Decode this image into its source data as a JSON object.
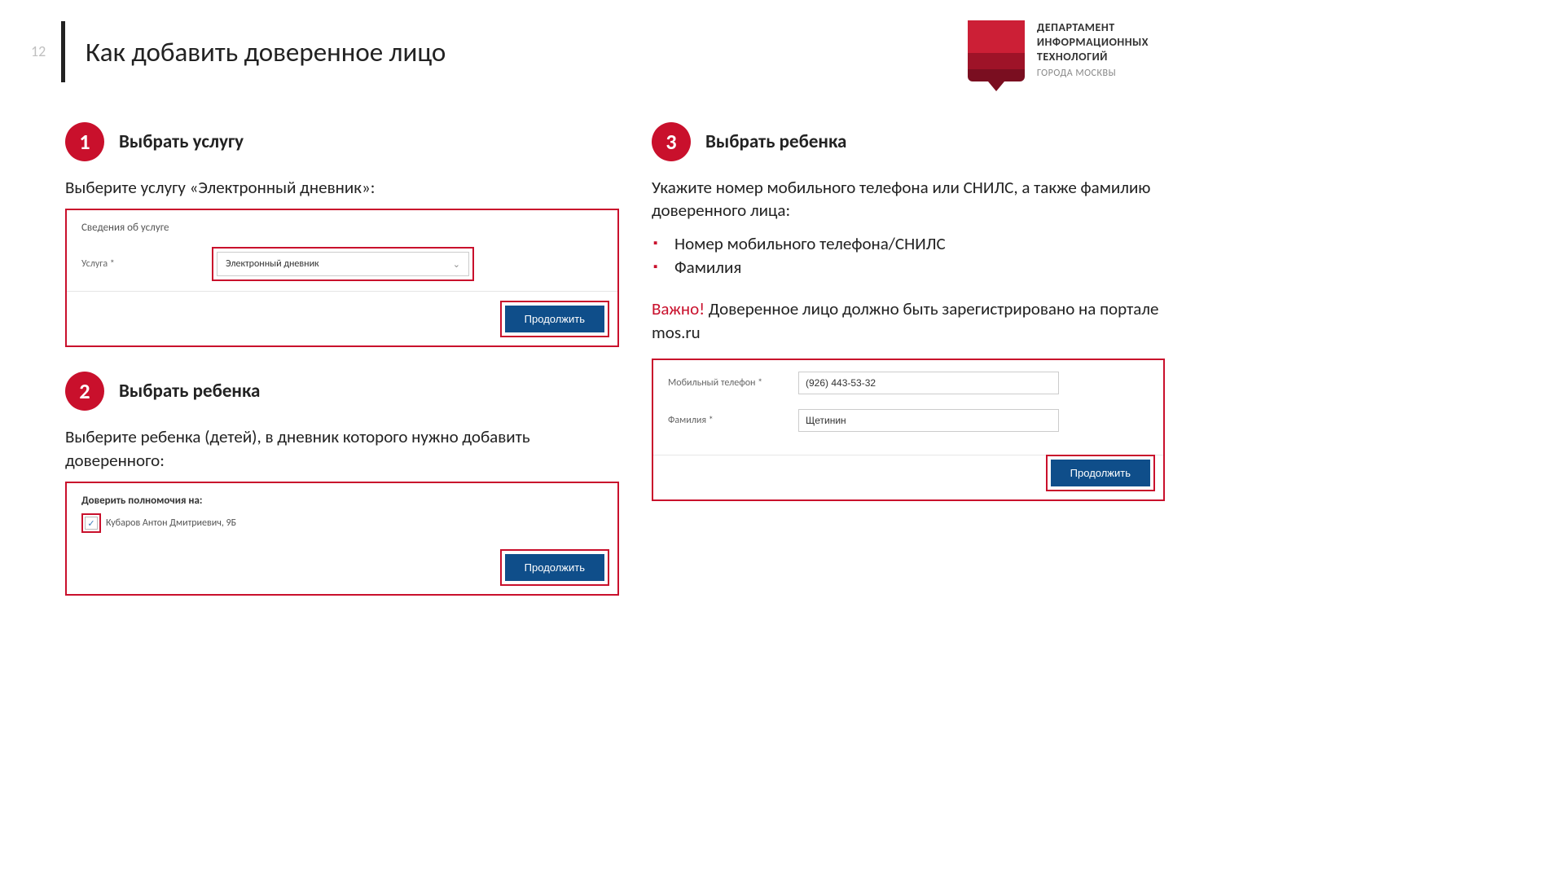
{
  "page_number": "12",
  "page_title": "Как добавить доверенное лицо",
  "department": {
    "line1": "ДЕПАРТАМЕНТ",
    "line2": "ИНФОРМАЦИОННЫХ",
    "line3": "ТЕХНОЛОГИЙ",
    "line4": "ГОРОДА МОСКВЫ"
  },
  "step1": {
    "num": "1",
    "title": "Выбрать услугу",
    "text": "Выберите услугу «Электронный дневник»:",
    "panel": {
      "heading": "Сведения об услуге",
      "field_label": "Услуга *",
      "select_value": "Электронный дневник",
      "button": "Продолжить"
    }
  },
  "step2": {
    "num": "2",
    "title": "Выбрать ребенка",
    "text": "Выберите ребенка (детей), в дневник которого нужно добавить доверенного:",
    "panel": {
      "heading": "Доверить полномочия на:",
      "child": "Кубаров Антон Дмитриевич, 9Б",
      "button": "Продолжить"
    }
  },
  "step3": {
    "num": "3",
    "title": "Выбрать ребенка",
    "text": "Укажите номер мобильного телефона или СНИЛС, а также фамилию доверенного лица:",
    "bullets": [
      "Номер мобильного телефона/СНИЛС",
      "Фамилия"
    ],
    "important_prefix": "Важно!",
    "important_text": " Доверенное лицо должно быть зарегистрировано на портале mos.ru",
    "panel": {
      "phone_label": "Мобильный телефон *",
      "phone_value": "(926) 443-53-32",
      "lastname_label": "Фамилия *",
      "lastname_value": "Щетинин",
      "button": "Продолжить"
    }
  }
}
